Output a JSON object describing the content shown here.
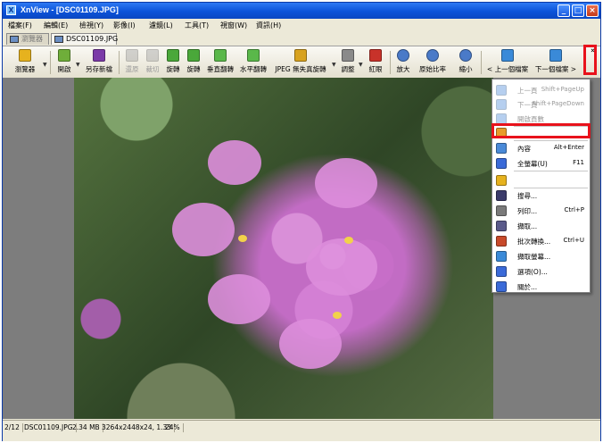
{
  "window": {
    "title": "XnView - [DSC01109.JPG]",
    "controls": {
      "minimize": "_",
      "maximize": "□",
      "close": "×"
    }
  },
  "menubar": {
    "items": [
      "檔案(F)",
      "編輯(E)",
      "檢視(Y)",
      "影像(I)",
      "濾鏡(L)",
      "工具(T)",
      "視窗(W)",
      "資訊(H)"
    ]
  },
  "tabs": [
    {
      "label": "瀏覽器",
      "active": false
    },
    {
      "label": "DSC01109.JPG",
      "active": true
    }
  ],
  "toolbar": {
    "buttons": [
      {
        "label": "瀏覽器",
        "icon": "folder-tree-icon",
        "color": "#e6b21e",
        "enabled": true,
        "dropdown": true
      },
      {
        "label": "開啟",
        "icon": "open-folder-icon",
        "color": "#6fae3a",
        "enabled": true,
        "dropdown": true
      },
      {
        "label": "另存新檔",
        "icon": "save-disk-icon",
        "color": "#7b3aa8",
        "enabled": true,
        "dropdown": false
      },
      {
        "label": "還原",
        "icon": "undo-icon",
        "color": "#9a9a9a",
        "enabled": false,
        "dropdown": false
      },
      {
        "label": "裁切",
        "icon": "crop-icon",
        "color": "#9a9a9a",
        "enabled": false,
        "dropdown": false
      },
      {
        "label": "旋轉",
        "icon": "rotate-left-icon",
        "color": "#4aa83a",
        "enabled": true,
        "dropdown": false
      },
      {
        "label": "旋轉",
        "icon": "rotate-right-icon",
        "color": "#4aa83a",
        "enabled": true,
        "dropdown": false
      },
      {
        "label": "垂直翻轉",
        "icon": "flip-vertical-icon",
        "color": "#5ab84a",
        "enabled": true,
        "dropdown": false
      },
      {
        "label": "水平翻轉",
        "icon": "flip-horizontal-icon",
        "color": "#5ab84a",
        "enabled": true,
        "dropdown": false
      },
      {
        "label": "JPEG 無失真旋轉",
        "icon": "jpeg-lossless-icon",
        "color": "#d8a21e",
        "enabled": true,
        "dropdown": true
      },
      {
        "label": "調整",
        "icon": "adjust-icon",
        "color": "#8a8a8a",
        "enabled": true,
        "dropdown": true
      },
      {
        "label": "紅眼",
        "icon": "red-eye-icon",
        "color": "#c8322a",
        "enabled": true,
        "dropdown": false
      },
      {
        "label": "放大",
        "icon": "zoom-in-icon",
        "color": "#4a7ac8",
        "enabled": true,
        "dropdown": false
      },
      {
        "label": "原始比率",
        "icon": "zoom-original-icon",
        "color": "#4a7ac8",
        "enabled": true,
        "dropdown": false
      },
      {
        "label": "縮小",
        "icon": "zoom-out-icon",
        "color": "#4a7ac8",
        "enabled": true,
        "dropdown": false
      },
      {
        "label": "< 上一個檔案",
        "icon": "arrow-left-icon",
        "color": "#3a8ad8",
        "enabled": true,
        "dropdown": false
      },
      {
        "label": "下一個檔案 >",
        "icon": "arrow-right-icon",
        "color": "#3a8ad8",
        "enabled": true,
        "dropdown": false
      }
    ],
    "overflow_label": "»"
  },
  "overflow_menu": {
    "items": [
      {
        "label": "上一頁",
        "shortcut": "Shift+PageUp",
        "icon": "page-up-icon",
        "color": "#4a8ad8",
        "enabled": false
      },
      {
        "label": "下一頁",
        "shortcut": "Shift+PageDown",
        "icon": "page-down-icon",
        "color": "#4a8ad8",
        "enabled": false
      },
      {
        "label": "開啟頁數",
        "shortcut": "",
        "icon": "page-select-icon",
        "color": "#4a8ad8",
        "enabled": false
      },
      {
        "label": "",
        "shortcut": "",
        "icon": "image-icon",
        "color": "#e89a2a",
        "enabled": true
      },
      {
        "label": "內容",
        "shortcut": "Alt+Enter",
        "icon": "properties-icon",
        "color": "#4a8ad8",
        "enabled": true
      },
      {
        "label": "全螢幕(U)",
        "shortcut": "F11",
        "icon": "fullscreen-icon",
        "color": "#3a6ad8",
        "enabled": true
      },
      {
        "label": "",
        "shortcut": "",
        "icon": "folder-open-icon",
        "color": "#e6b21e",
        "enabled": true
      },
      {
        "label": "搜尋...",
        "shortcut": "",
        "icon": "binoculars-icon",
        "color": "#3a3a6a",
        "enabled": true
      },
      {
        "label": "列印...",
        "shortcut": "Ctrl+P",
        "icon": "printer-icon",
        "color": "#7a7a7a",
        "enabled": true
      },
      {
        "label": "擷取...",
        "shortcut": "",
        "icon": "capture-icon",
        "color": "#5a5a8a",
        "enabled": true
      },
      {
        "label": "批次轉換...",
        "shortcut": "Ctrl+U",
        "icon": "batch-convert-icon",
        "color": "#c84a2a",
        "enabled": true
      },
      {
        "label": "擷取螢幕...",
        "shortcut": "",
        "icon": "screen-capture-icon",
        "color": "#3a8ad8",
        "enabled": true
      },
      {
        "label": "選項(O)...",
        "shortcut": "",
        "icon": "options-icon",
        "color": "#3a6ad8",
        "enabled": true
      },
      {
        "label": "關於...",
        "shortcut": "",
        "icon": "help-icon",
        "color": "#3a6ad8",
        "enabled": true
      }
    ]
  },
  "statusbar": {
    "cells": [
      "2/12",
      "DSC01109.JPG",
      "2.34 MB",
      "3264x2448x24, 1.33",
      "24%"
    ]
  },
  "colors": {
    "highlight": "#e8121c",
    "titlebar": "#0b53d9"
  }
}
